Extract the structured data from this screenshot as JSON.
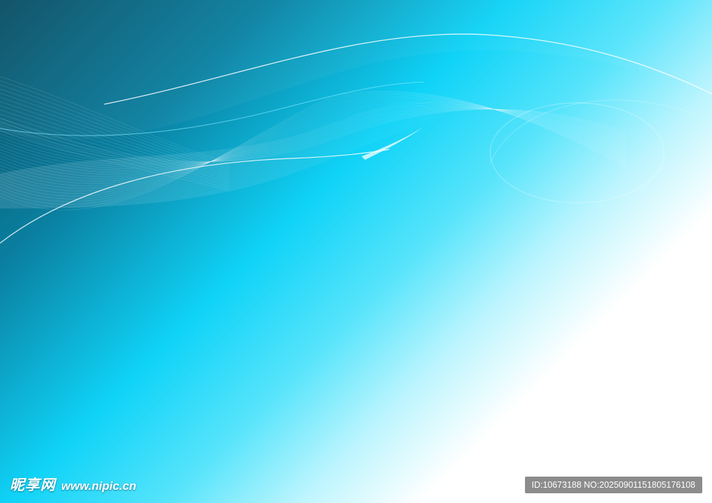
{
  "watermark": {
    "brand": "昵享网",
    "url": "www.nipic.cn"
  },
  "badge": {
    "text": "ID:10673188 NO:20250901151805176108"
  },
  "colors": {
    "dark_teal": "#0a4e63",
    "cyan": "#0fd3f7",
    "light_cyan": "#bdf5fe",
    "white": "#ffffff"
  }
}
